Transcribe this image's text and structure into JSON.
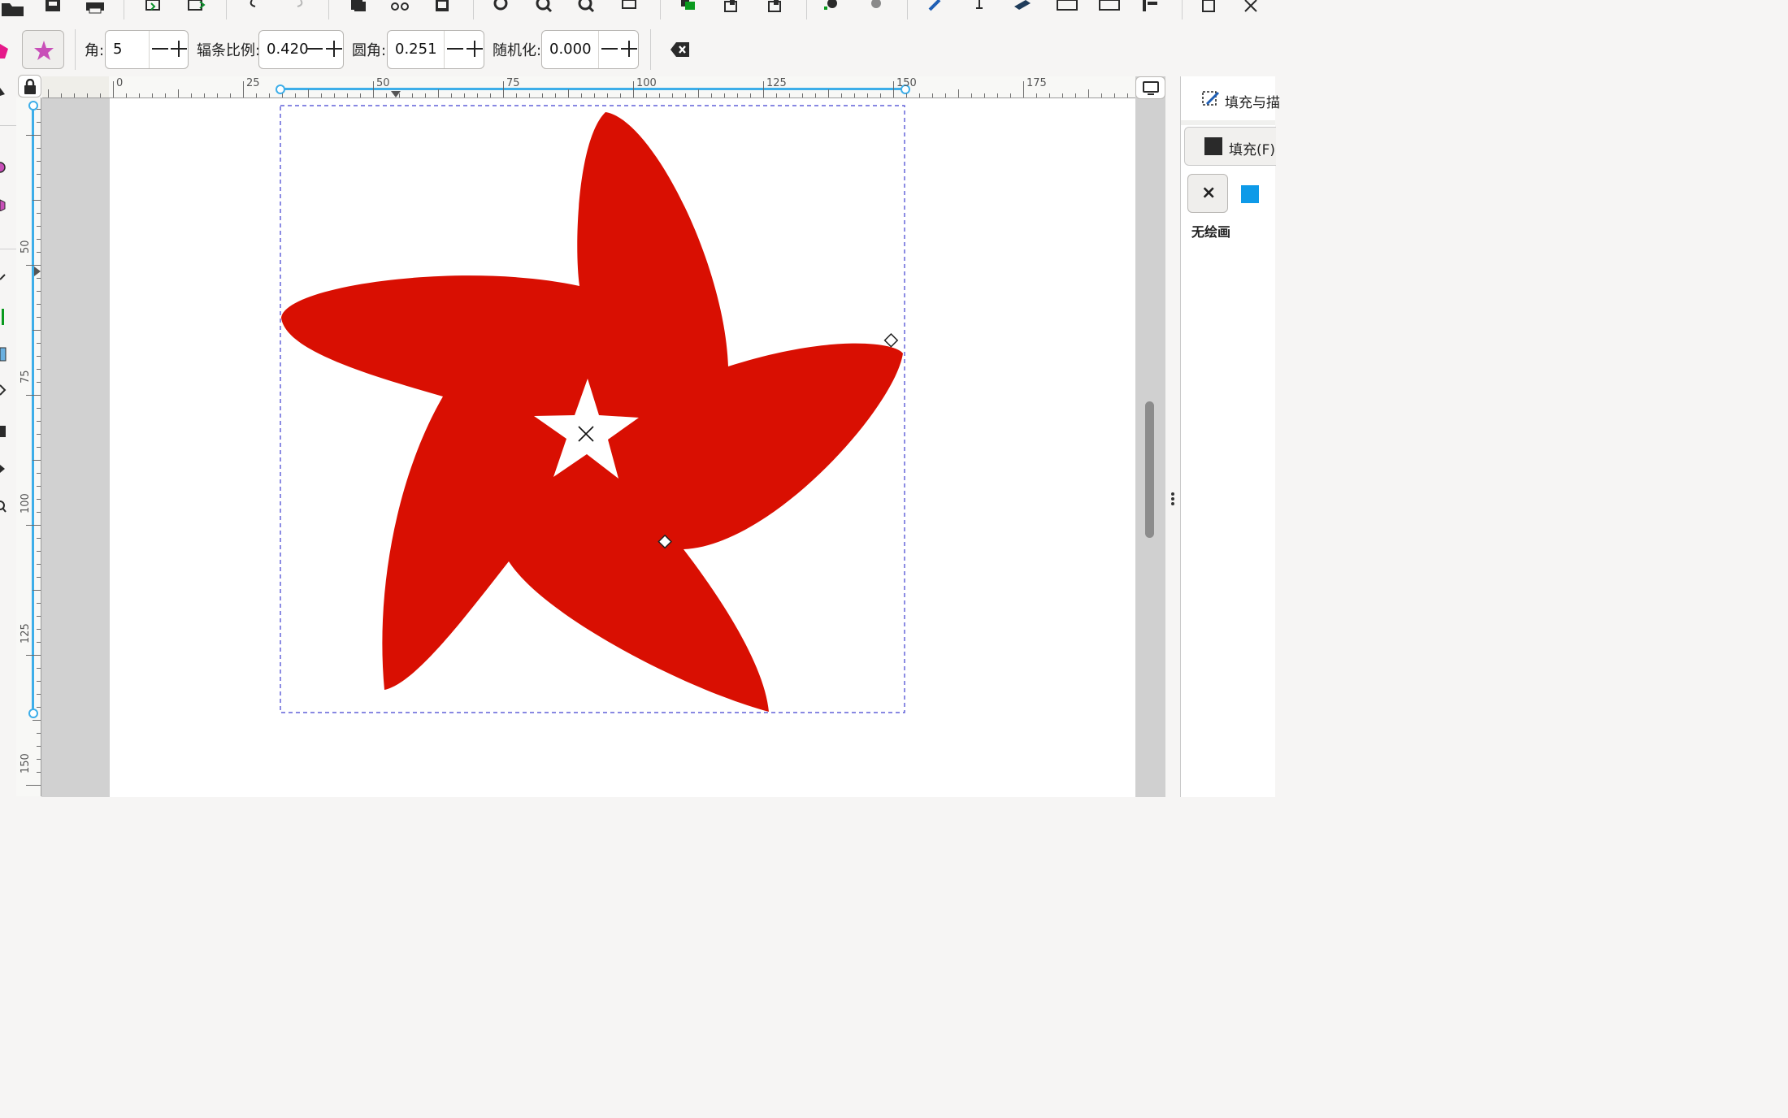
{
  "toolbar": {
    "corners_label": "角:",
    "corners_value": "5",
    "spoke_ratio_label": "辐条比例:",
    "spoke_ratio_value": "0.420",
    "rounded_label": "圆角:",
    "rounded_value": "0.251",
    "randomized_label": "随机化:",
    "randomized_value": "0.000"
  },
  "ruler": {
    "horizontal": [
      "0",
      "25",
      "50",
      "75",
      "100",
      "125",
      "150",
      "175"
    ],
    "vertical": [
      "50",
      "75",
      "100",
      "125",
      "150"
    ]
  },
  "panel": {
    "tab_label": "填充与描",
    "fill_tab_label": "填充(F)",
    "no_paint_label": "无绘画"
  },
  "colors": {
    "shape_fill": "#d90f02",
    "selection_accent": "#3daee9",
    "star_tool_icon": "#c84fb8",
    "swatch": "#0e9ae8"
  },
  "icons": {
    "close": "×",
    "clear": "⌫"
  }
}
